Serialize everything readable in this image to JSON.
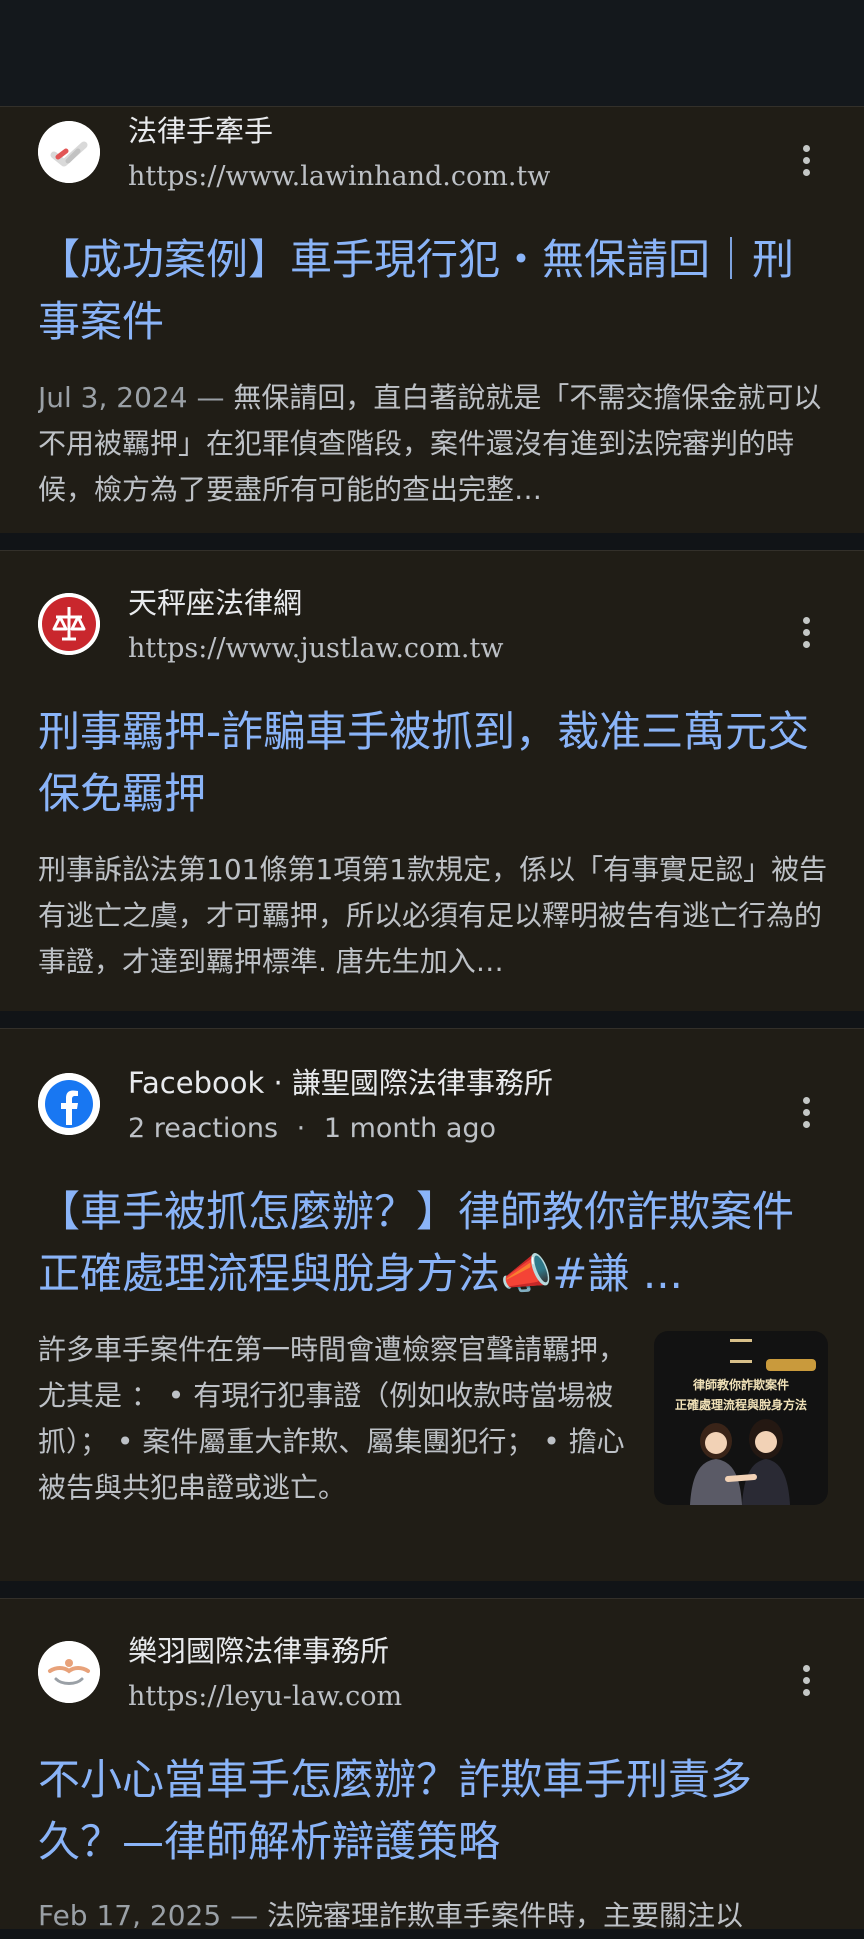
{
  "results": [
    {
      "site_name": "法律手牽手",
      "url": "https://www.lawinhand.com.tw",
      "title": "【成功案例】車手現行犯・無保請回｜刑事案件",
      "date": "Jul 3, 2024 — ",
      "snippet": "無保請回，直白著說就是「不需交擔保金就可以不用被羈押」在犯罪偵查階段，案件還沒有進到法院審判的時候，檢方為了要盡所有可能的查出完整…"
    },
    {
      "site_name": "天秤座法律網",
      "url": "https://www.justlaw.com.tw",
      "title": "刑事羈押-詐騙車手被抓到，裁准三萬元交保免羈押",
      "snippet": "刑事訴訟法第101條第1項第1款規定，係以「有事實足認」被告有逃亡之虞，才可羈押，所以必須有足以釋明被告有逃亡行為的事證，才達到羈押標準. 唐先生加入…"
    },
    {
      "site_name": "Facebook · 謙聖國際法律事務所",
      "reactions": "2 reactions",
      "separator": "·",
      "time_ago": "1 month ago",
      "title": "【車手被抓怎麼辦？】律師教你詐欺案件正確處理流程與脫身方法📣#謙 ...",
      "snippet": "許多車手案件在第一時間會遭檢察官聲請羈押，尤其是 ： • 有現行犯事證（例如收款時當場被抓）； • 案件屬重大詐欺、屬集團犯行； • 擔心被告與共犯串證或逃亡。",
      "thumbnail_text_1": "律師教你詐欺案件",
      "thumbnail_text_2": "正確處理流程與脫身方法"
    },
    {
      "site_name": "樂羽國際法律事務所",
      "url": "https://leyu-law.com",
      "title": "不小心當車手怎麼辦？詐欺車手刑責多久？—律師解析辯護策略",
      "date": "Feb 17, 2025 — ",
      "snippet": "法院審理詐欺車手案件時，主要關注以"
    }
  ],
  "icons": {
    "favicon_1": "handshake-icon",
    "favicon_2": "scales-icon",
    "favicon_3": "facebook-icon",
    "favicon_4": "hands-icon",
    "menu": "more-vert-icon"
  },
  "colors": {
    "background": "#111417",
    "card": "#201d16",
    "link": "#8ab4f8",
    "text": "#e8eaed",
    "muted": "#bdc1c6"
  }
}
